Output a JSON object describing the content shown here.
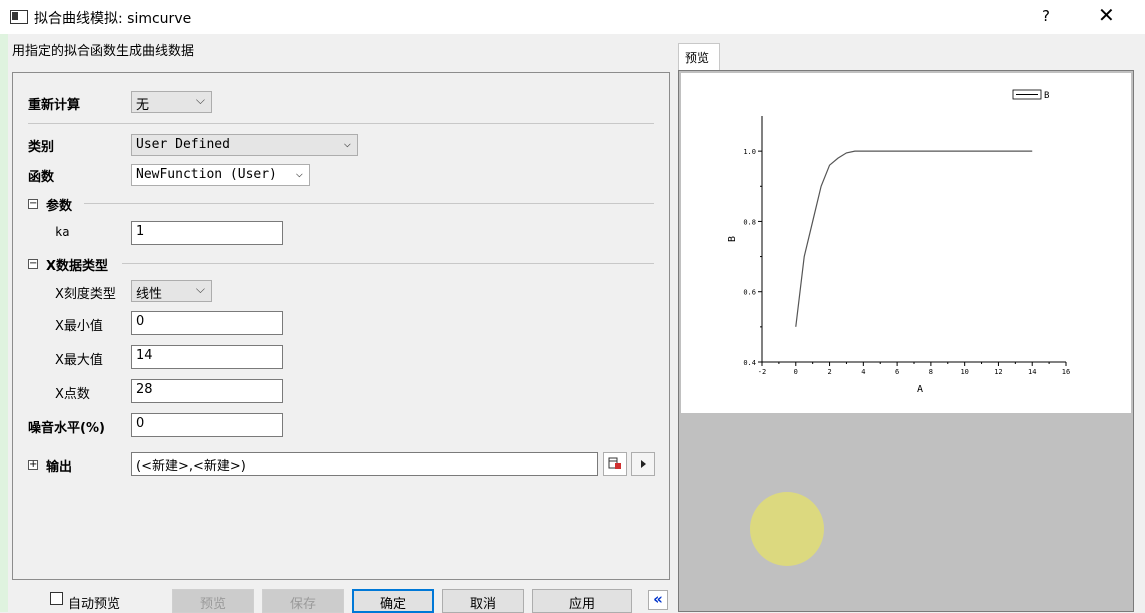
{
  "window": {
    "title": "拟合曲线模拟: simcurve",
    "help": "?",
    "close": "✕"
  },
  "description": "用指定的拟合函数生成曲线数据",
  "form": {
    "recalc": {
      "label": "重新计算",
      "value": "无"
    },
    "category": {
      "label": "类别",
      "value": "User Defined"
    },
    "function": {
      "label": "函数",
      "value": "NewFunction (User)"
    },
    "params": {
      "label": "参数",
      "toggle": "−",
      "ka_label": "ka",
      "ka_value": "1"
    },
    "xdata": {
      "label": "X数据类型",
      "toggle": "−",
      "scale_label": "X刻度类型",
      "scale_value": "线性",
      "min_label": "X最小值",
      "min_value": "0",
      "max_label": "X最大值",
      "max_value": "14",
      "points_label": "X点数",
      "points_value": "28"
    },
    "noise": {
      "label": "噪音水平(%)",
      "value": "0"
    },
    "output": {
      "label": "输出",
      "toggle": "+",
      "value": "(<新建>,<新建>)"
    }
  },
  "buttons": {
    "auto_preview": "自动预览",
    "preview": "预览",
    "save": "保存",
    "ok": "确定",
    "cancel": "取消",
    "apply": "应用",
    "collapse": "«"
  },
  "preview_tab": "预览",
  "chart_data": {
    "type": "line",
    "xlabel": "A",
    "ylabel": "B",
    "xlim": [
      -2,
      16
    ],
    "ylim": [
      0.4,
      1.1
    ],
    "xticks": [
      "-2",
      "0",
      "2",
      "4",
      "6",
      "8",
      "10",
      "12",
      "14",
      "16"
    ],
    "yticks": [
      "0.4",
      "0.6",
      "0.8",
      "1.0"
    ],
    "legend": "top-right",
    "series": [
      {
        "name": "B",
        "x": [
          0,
          0.5,
          1,
          1.5,
          2,
          2.5,
          3,
          3.5,
          4,
          4.5,
          5,
          5.5,
          6,
          6.5,
          7,
          7.5,
          8,
          8.5,
          9,
          9.5,
          10,
          10.5,
          11,
          11.5,
          12,
          12.5,
          13,
          13.5,
          14
        ],
        "y": [
          0.5,
          0.7,
          0.8,
          0.9,
          0.96,
          0.98,
          0.995,
          1,
          1,
          1,
          1,
          1,
          1,
          1,
          1,
          1,
          1,
          1,
          1,
          1,
          1,
          1,
          1,
          1,
          1,
          1,
          1,
          1,
          1
        ]
      }
    ]
  }
}
